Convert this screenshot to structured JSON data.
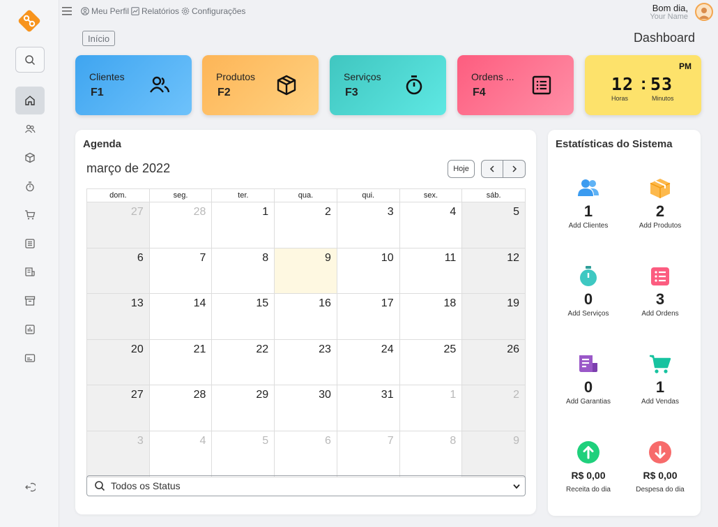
{
  "topbar": {
    "links": [
      {
        "label": "Meu Perfil",
        "icon": "user-circle-icon"
      },
      {
        "label": "Relatórios",
        "icon": "chart-icon"
      },
      {
        "label": "Configurações",
        "icon": "gear-icon"
      }
    ],
    "greeting": "Bom dia,",
    "username": "Your Name"
  },
  "breadcrumb": "Início",
  "page_title": "Dashboard",
  "shortcuts": [
    {
      "label": "Clientes",
      "key": "F1",
      "icon": "users-icon",
      "color": "#4aabf3"
    },
    {
      "label": "Produtos",
      "key": "F2",
      "icon": "box-icon",
      "color": "#fec36a"
    },
    {
      "label": "Serviços",
      "key": "F3",
      "icon": "stopwatch-icon",
      "color": "#4fd6d1"
    },
    {
      "label": "Ordens ...",
      "key": "F4",
      "icon": "list-icon",
      "color": "#fe718f"
    }
  ],
  "clock": {
    "hours": "12",
    "minutes": "53",
    "period": "PM",
    "hours_label": "Horas",
    "minutes_label": "Minutos",
    "separator": ":"
  },
  "agenda": {
    "title": "Agenda",
    "month": "março de 2022",
    "today_button": "Hoje",
    "weekdays": [
      "dom.",
      "seg.",
      "ter.",
      "qua.",
      "qui.",
      "sex.",
      "sáb."
    ],
    "weeks": [
      [
        "27",
        "28",
        "1",
        "2",
        "3",
        "4",
        "5"
      ],
      [
        "6",
        "7",
        "8",
        "9",
        "10",
        "11",
        "12"
      ],
      [
        "13",
        "14",
        "15",
        "16",
        "17",
        "18",
        "19"
      ],
      [
        "20",
        "21",
        "22",
        "23",
        "24",
        "25",
        "26"
      ],
      [
        "27",
        "28",
        "29",
        "30",
        "31",
        "1",
        "2"
      ],
      [
        "3",
        "4",
        "5",
        "6",
        "7",
        "8",
        "9"
      ]
    ],
    "status_filter": "Todos os Status"
  },
  "stats": {
    "title": "Estatísticas do Sistema",
    "items": [
      {
        "value": "1",
        "label": "Add Clientes",
        "icon": "users-icon",
        "color": "#3b9bf0"
      },
      {
        "value": "2",
        "label": "Add Produtos",
        "icon": "box-icon",
        "color": "#fdb94c"
      },
      {
        "value": "0",
        "label": "Add Serviços",
        "icon": "stopwatch-icon",
        "color": "#3ec8c2"
      },
      {
        "value": "3",
        "label": "Add Ordens",
        "icon": "list-icon",
        "color": "#fc5c80"
      },
      {
        "value": "0",
        "label": "Add Garantias",
        "icon": "receipt-icon",
        "color": "#9a58c8"
      },
      {
        "value": "1",
        "label": "Add Vendas",
        "icon": "cart-icon",
        "color": "#17c3a0"
      },
      {
        "value": "R$ 0,00",
        "label": "Receita do dia",
        "icon": "arrow-up-circle-icon",
        "color": "#1fd07c"
      },
      {
        "value": "R$ 0,00",
        "label": "Despesa do dia",
        "icon": "arrow-down-circle-icon",
        "color": "#f76b6b"
      }
    ]
  }
}
